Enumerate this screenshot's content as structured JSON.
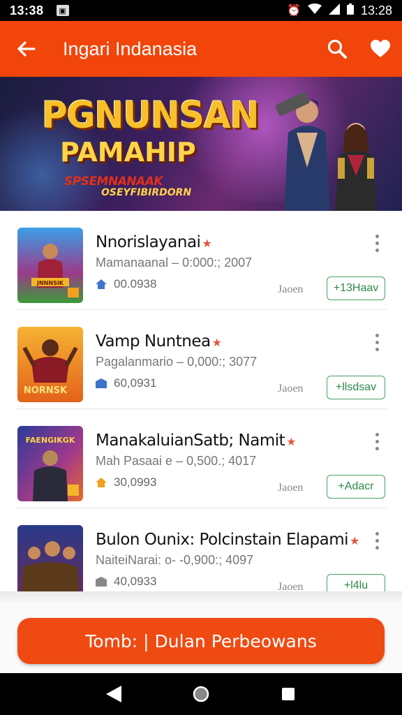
{
  "status_bar": {
    "time_left": "13:38",
    "time_right": "13:28"
  },
  "app_bar": {
    "title": "Ingari Indanasia"
  },
  "banner": {
    "headline": "PGNUNSAN",
    "line2": "PAMAHIP",
    "line3": "SPSEMNANAAK",
    "line4": "OSEYFIBIRDORN"
  },
  "apps": [
    {
      "name": "Nnorislayanai",
      "meta": "Mamanaanal – 0:000:; 2007",
      "count": "00.0938",
      "lang": "Jaoen",
      "install_label": "+13Haav",
      "thumb_text": "JNNNSIK"
    },
    {
      "name": "Vamp Nuntnea",
      "meta": "Pagalanmario – 0,000:; 3077",
      "count": "60,0931",
      "lang": "Jaoen",
      "install_label": "+llsdsav",
      "thumb_text": "NORNSK"
    },
    {
      "name": "ManakaluianSatb; Namit",
      "meta": "Mah Pasaai e – 0,500.; 4017",
      "count": "30,0993",
      "lang": "Jaoen",
      "install_label": "+Adacr",
      "thumb_text": "FAENGIKGK"
    },
    {
      "name": "Bulon Ounix: Polcinstain Elapami",
      "meta": "NaiteiNarai: o- -0,900:; 4097",
      "count": "40,0933",
      "lang": "Jaoen",
      "install_label": "+l4lu",
      "thumb_text": ""
    }
  ],
  "cta": {
    "label": "Tomb: | Dulan Perbeowans"
  },
  "colors": {
    "accent": "#f2450b",
    "install_green": "#2c8a48"
  }
}
